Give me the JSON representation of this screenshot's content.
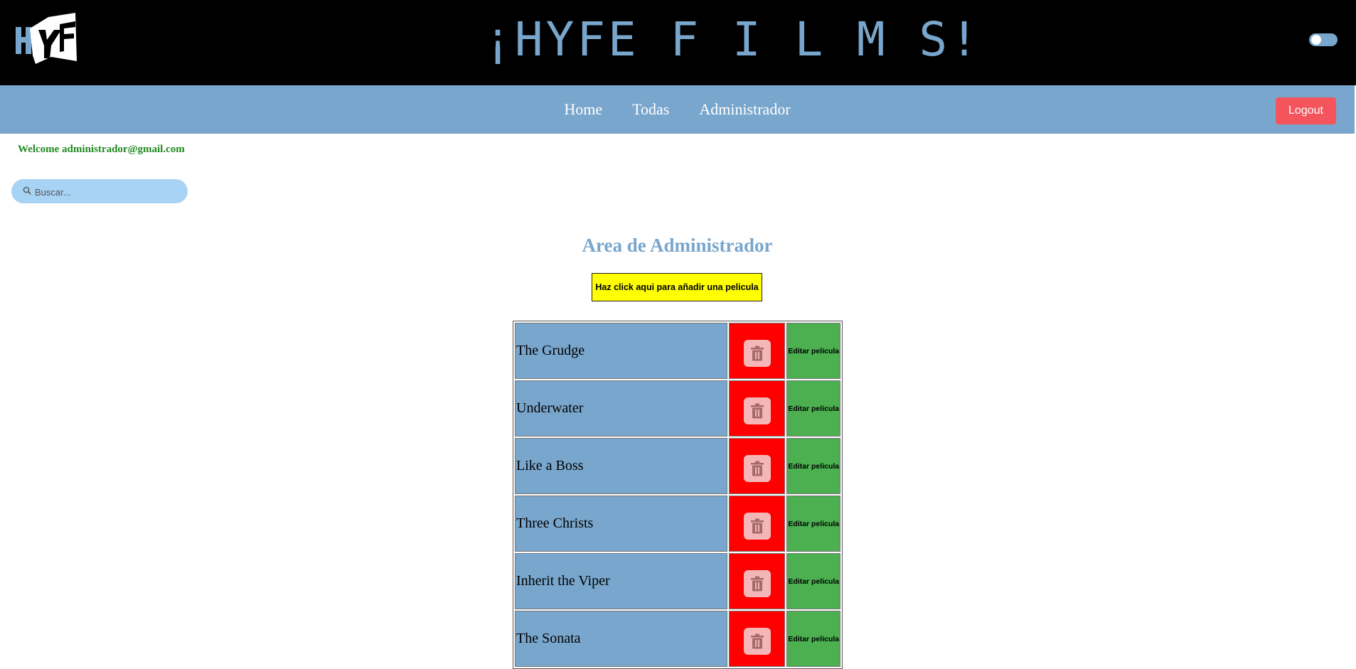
{
  "header": {
    "logo_text": "HYFE",
    "site_title": "¡HYFE F I L M S!",
    "theme_toggle": "toggle-switch"
  },
  "nav": {
    "links": [
      {
        "label": "Home"
      },
      {
        "label": "Todas"
      },
      {
        "label": "Administrador"
      }
    ],
    "logout_label": "Logout"
  },
  "user": {
    "welcome": "Welcome administrador@gmail.com"
  },
  "search": {
    "placeholder": "Buscar...",
    "icon": "search-icon"
  },
  "admin": {
    "heading": "Area de Administrador",
    "add_label": "Haz click aqui para añadir una pelicula",
    "delete_icon": "trash-icon",
    "films": [
      {
        "title": "The Grudge",
        "edit_label": "Editar pelicula"
      },
      {
        "title": "Underwater",
        "edit_label": "Editar pelicula"
      },
      {
        "title": "Like a Boss",
        "edit_label": "Editar pelicula"
      },
      {
        "title": "Three Christs",
        "edit_label": "Editar pelicula"
      },
      {
        "title": "Inherit the Viper",
        "edit_label": "Editar pelicula"
      },
      {
        "title": "The Sonata",
        "edit_label": "Editar pelicula"
      }
    ]
  },
  "colors": {
    "accent_blue": "#79a6cc",
    "delete_red": "#ff0000",
    "edit_green": "#4caf50",
    "add_yellow": "#ffff00",
    "logout_red": "#f4545c",
    "welcome_green": "#1f8a1f"
  }
}
